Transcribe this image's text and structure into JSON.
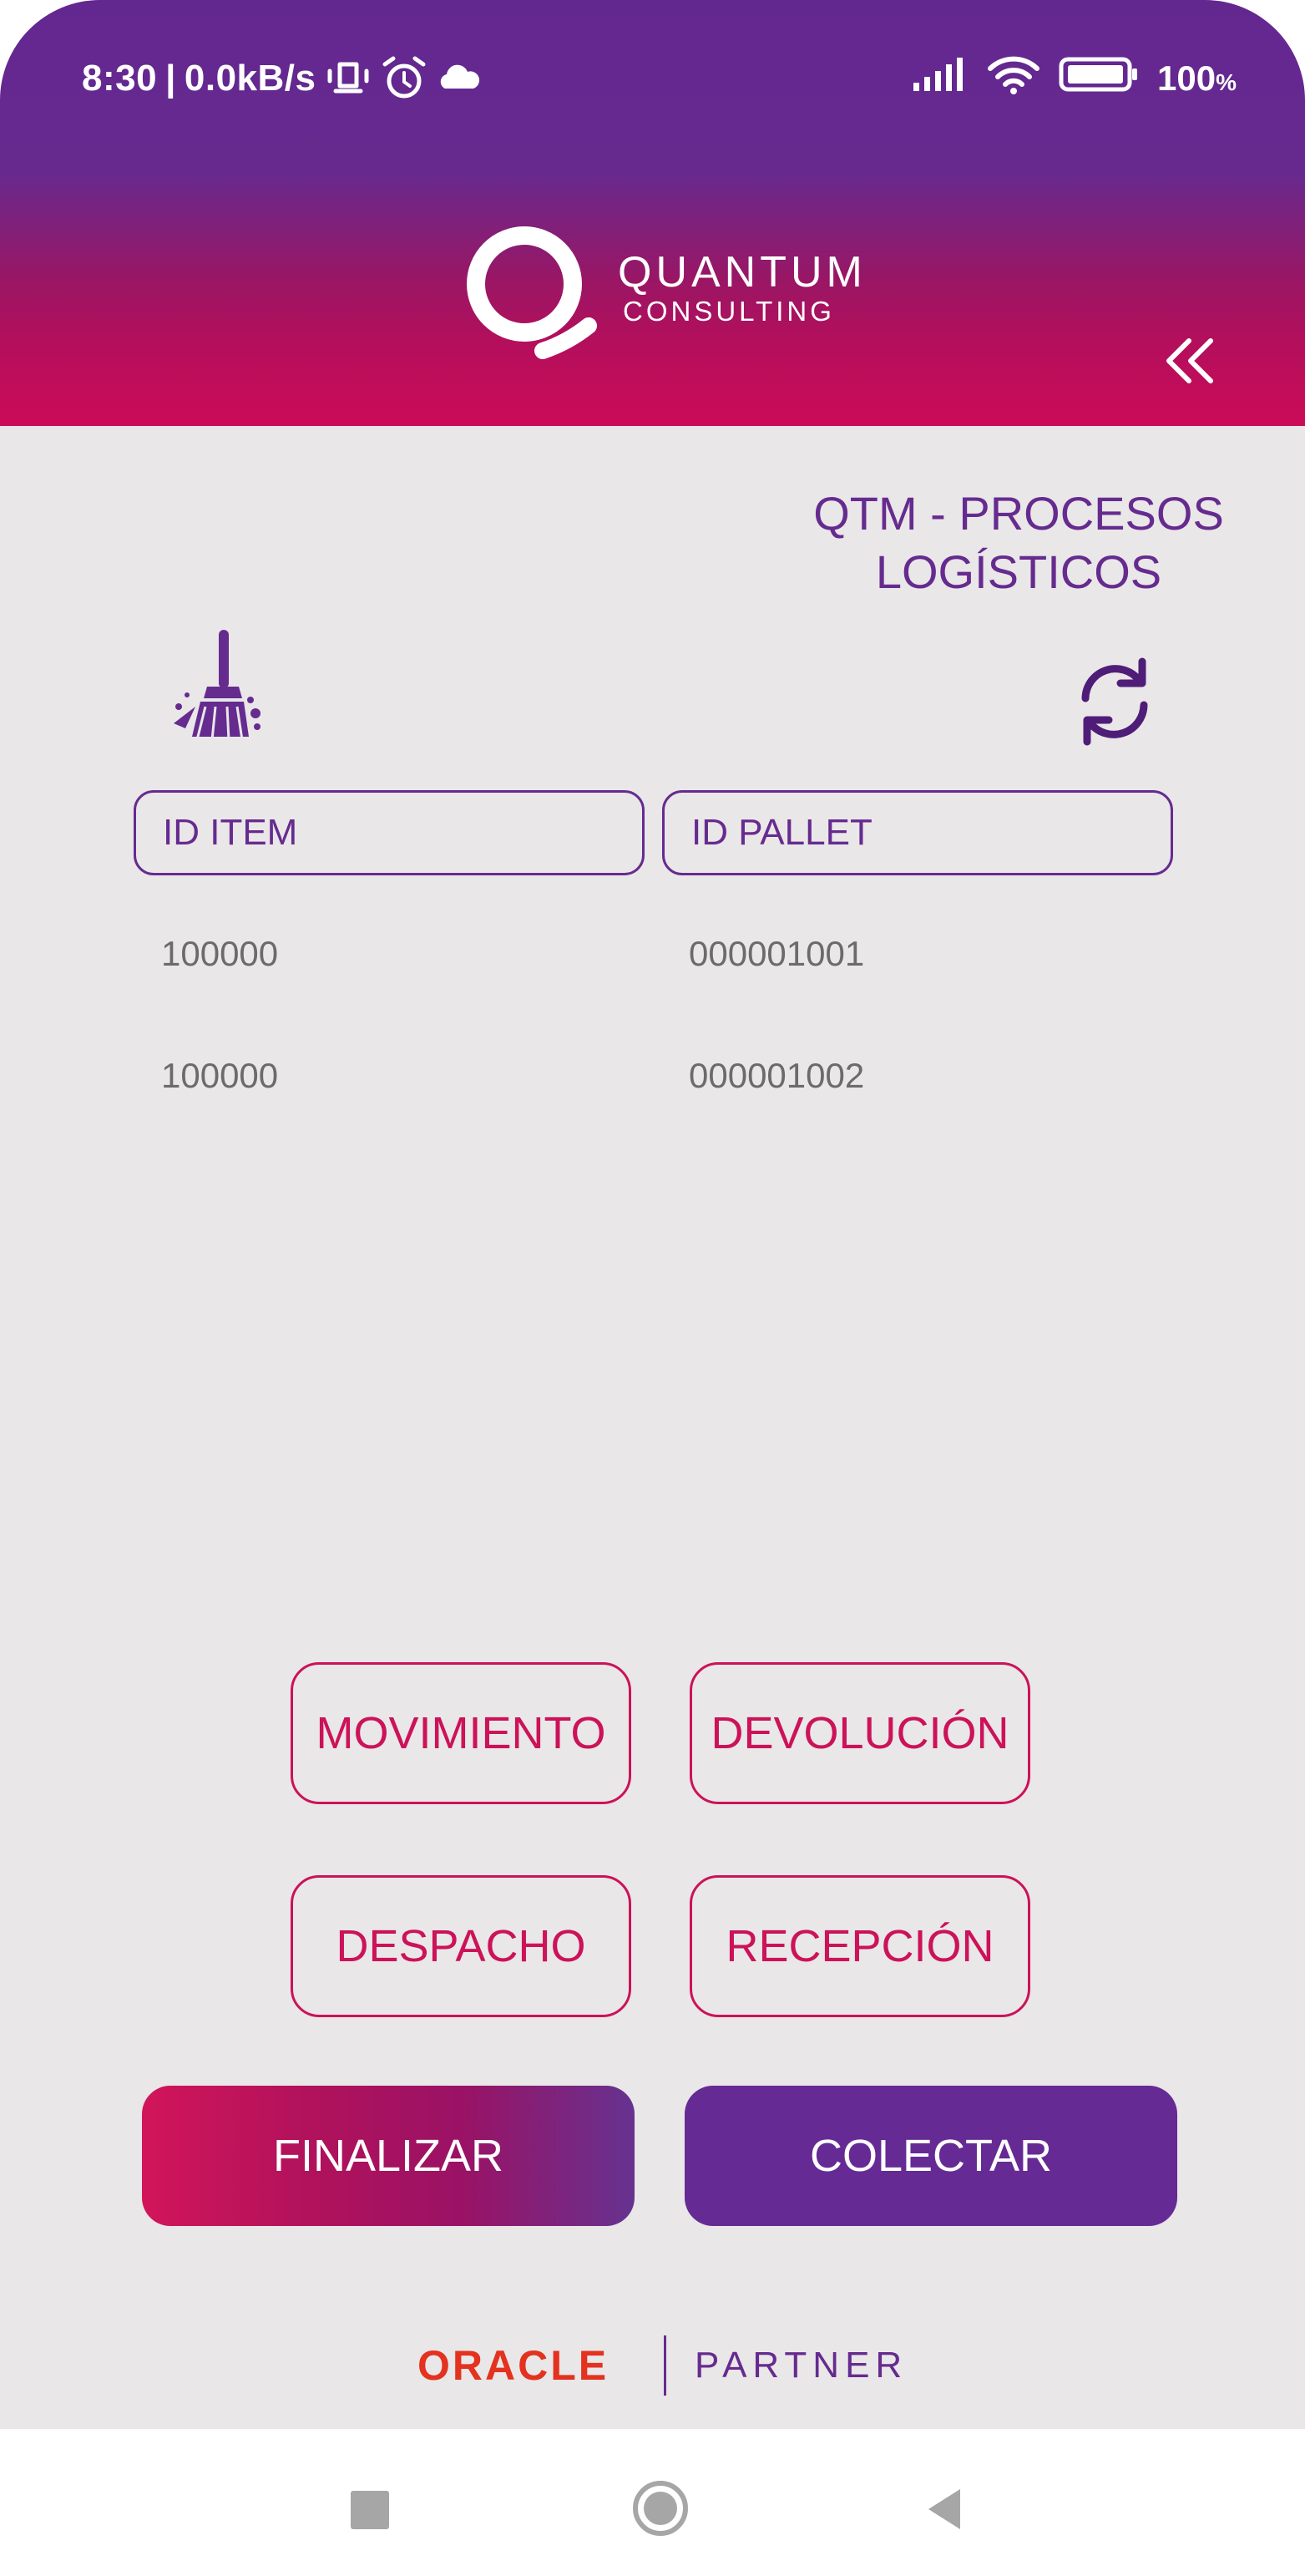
{
  "status_bar": {
    "time": "8:30",
    "separator": "|",
    "net_speed": "0.0kB/s",
    "battery": "100",
    "battery_unit": "%",
    "icons": [
      "vibrate-icon",
      "alarm-icon",
      "cloud-icon",
      "signal-icon",
      "wifi-icon",
      "battery-icon"
    ]
  },
  "header": {
    "logo_line1": "QUANTUM",
    "logo_line2": "CONSULTING",
    "collapse_icon": "double-chevron-left-icon"
  },
  "page": {
    "title_line1": "QTM - PROCESOS",
    "title_line2": "LOGÍSTICOS",
    "clear_icon": "broom-icon",
    "refresh_icon": "refresh-icon"
  },
  "table": {
    "columns": [
      "ID ITEM",
      "ID PALLET"
    ],
    "rows": [
      {
        "id_item": "100000",
        "id_pallet": "000001001"
      },
      {
        "id_item": "100000",
        "id_pallet": "000001002"
      }
    ]
  },
  "actions": {
    "movimiento": "MOVIMIENTO",
    "devolucion": "DEVOLUCIÓN",
    "despacho": "DESPACHO",
    "recepcion": "RECEPCIÓN",
    "finalizar": "FINALIZAR",
    "colectar": "COLECTAR"
  },
  "footer": {
    "oracle": "ORACLE",
    "partner": "PARTNER"
  },
  "colors": {
    "purple": "#662b8f",
    "magenta": "#cc1259",
    "background": "#e9e7e8",
    "oracle_red": "#e3321f"
  },
  "navbar": {
    "icons": [
      "recents-icon",
      "home-icon",
      "back-icon"
    ]
  }
}
